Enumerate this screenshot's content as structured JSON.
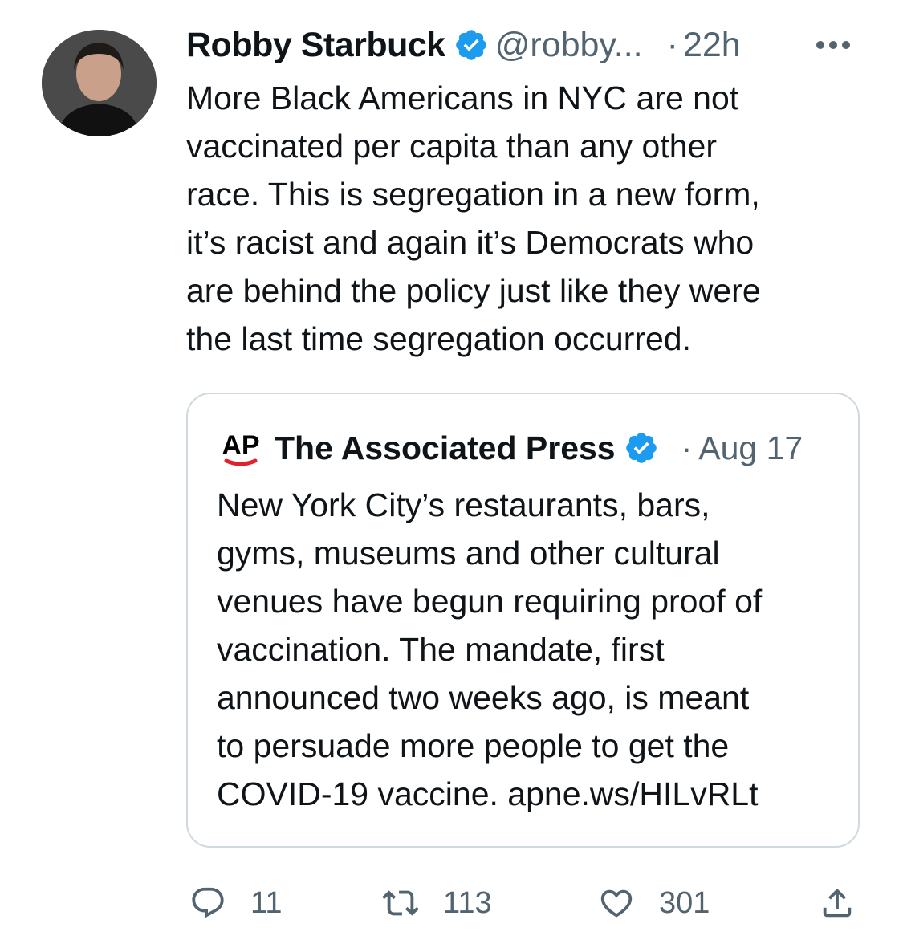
{
  "tweet": {
    "author_name": "Robby Starbuck",
    "handle": "@robby...",
    "dot": "·",
    "time": "22h",
    "text_lines": [
      "More Black Americans in NYC are not",
      "vaccinated per capita than any other",
      "race. This is segregation in a new form,",
      "it’s racist and again it’s Democrats who",
      "are behind the policy just like they were",
      "the last time segregation occurred."
    ]
  },
  "quoted": {
    "logo_text": "AP",
    "author_name": "The Associated Press",
    "dot": "·",
    "date": "Aug 17",
    "text_lines": [
      "New York City’s restaurants, bars,",
      "gyms, museums and other cultural",
      "venues have begun requiring proof of",
      "vaccination. The mandate, first",
      "announced two weeks ago, is meant",
      "to persuade more people to get the",
      "COVID-19 vaccine. apne.ws/HILvRLt"
    ]
  },
  "actions": {
    "reply_count": "11",
    "retweet_count": "113",
    "like_count": "301"
  },
  "icons": {
    "verified": "verified-badge-icon",
    "more": "more-icon",
    "reply": "reply-icon",
    "retweet": "retweet-icon",
    "like": "heart-icon",
    "share": "share-icon"
  },
  "colors": {
    "verified": "#1d9bf0",
    "secondary_text": "#536471",
    "border": "#cfd9de",
    "ap_red": "#e0202b"
  }
}
